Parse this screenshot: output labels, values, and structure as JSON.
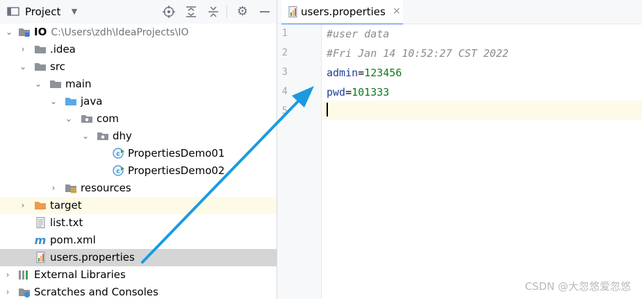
{
  "project_panel": {
    "title": "Project",
    "toolbar_icons": [
      "locate-icon",
      "expand-all-icon",
      "collapse-all-icon",
      "gear-icon",
      "hide-icon"
    ]
  },
  "tree": [
    {
      "label": "IO",
      "path": "C:\\Users\\zdh\\IdeaProjects\\IO",
      "icon": "module-folder-icon",
      "expanded": true
    },
    {
      "label": ".idea",
      "icon": "folder-icon",
      "expanded": false
    },
    {
      "label": "src",
      "icon": "folder-icon",
      "expanded": true
    },
    {
      "label": "main",
      "icon": "folder-icon",
      "expanded": true
    },
    {
      "label": "java",
      "icon": "source-folder-icon",
      "expanded": true
    },
    {
      "label": "com",
      "icon": "package-icon",
      "expanded": true
    },
    {
      "label": "dhy",
      "icon": "package-icon",
      "expanded": true
    },
    {
      "label": "PropertiesDemo01",
      "icon": "java-class-icon"
    },
    {
      "label": "PropertiesDemo02",
      "icon": "java-class-icon"
    },
    {
      "label": "resources",
      "icon": "resources-folder-icon",
      "expanded": false
    },
    {
      "label": "target",
      "icon": "excluded-folder-icon",
      "expanded": false
    },
    {
      "label": "list.txt",
      "icon": "text-file-icon"
    },
    {
      "label": "pom.xml",
      "icon": "maven-icon"
    },
    {
      "label": "users.properties",
      "icon": "properties-file-icon"
    },
    {
      "label": "External Libraries",
      "icon": "libraries-icon",
      "expanded": false
    },
    {
      "label": "Scratches and Consoles",
      "icon": "scratches-icon",
      "expanded": false
    }
  ],
  "editor": {
    "tab": {
      "label": "users.properties",
      "close": "×"
    },
    "line_numbers": [
      "1",
      "2",
      "3",
      "4",
      "5"
    ],
    "lines": [
      {
        "comment": "#user data"
      },
      {
        "comment": "#Fri Jan 14 10:52:27 CST 2022"
      },
      {
        "key": "admin",
        "eq": "=",
        "val": "123456"
      },
      {
        "key": "pwd",
        "eq": "=",
        "val": "101333"
      },
      {}
    ]
  },
  "watermark": "CSDN @大忽悠爱忽悠",
  "colors": {
    "arrow": "#1a9be0",
    "selection": "#d5d5d5",
    "current_line": "#fdfbe8",
    "tab_underline": "#3574f0"
  }
}
